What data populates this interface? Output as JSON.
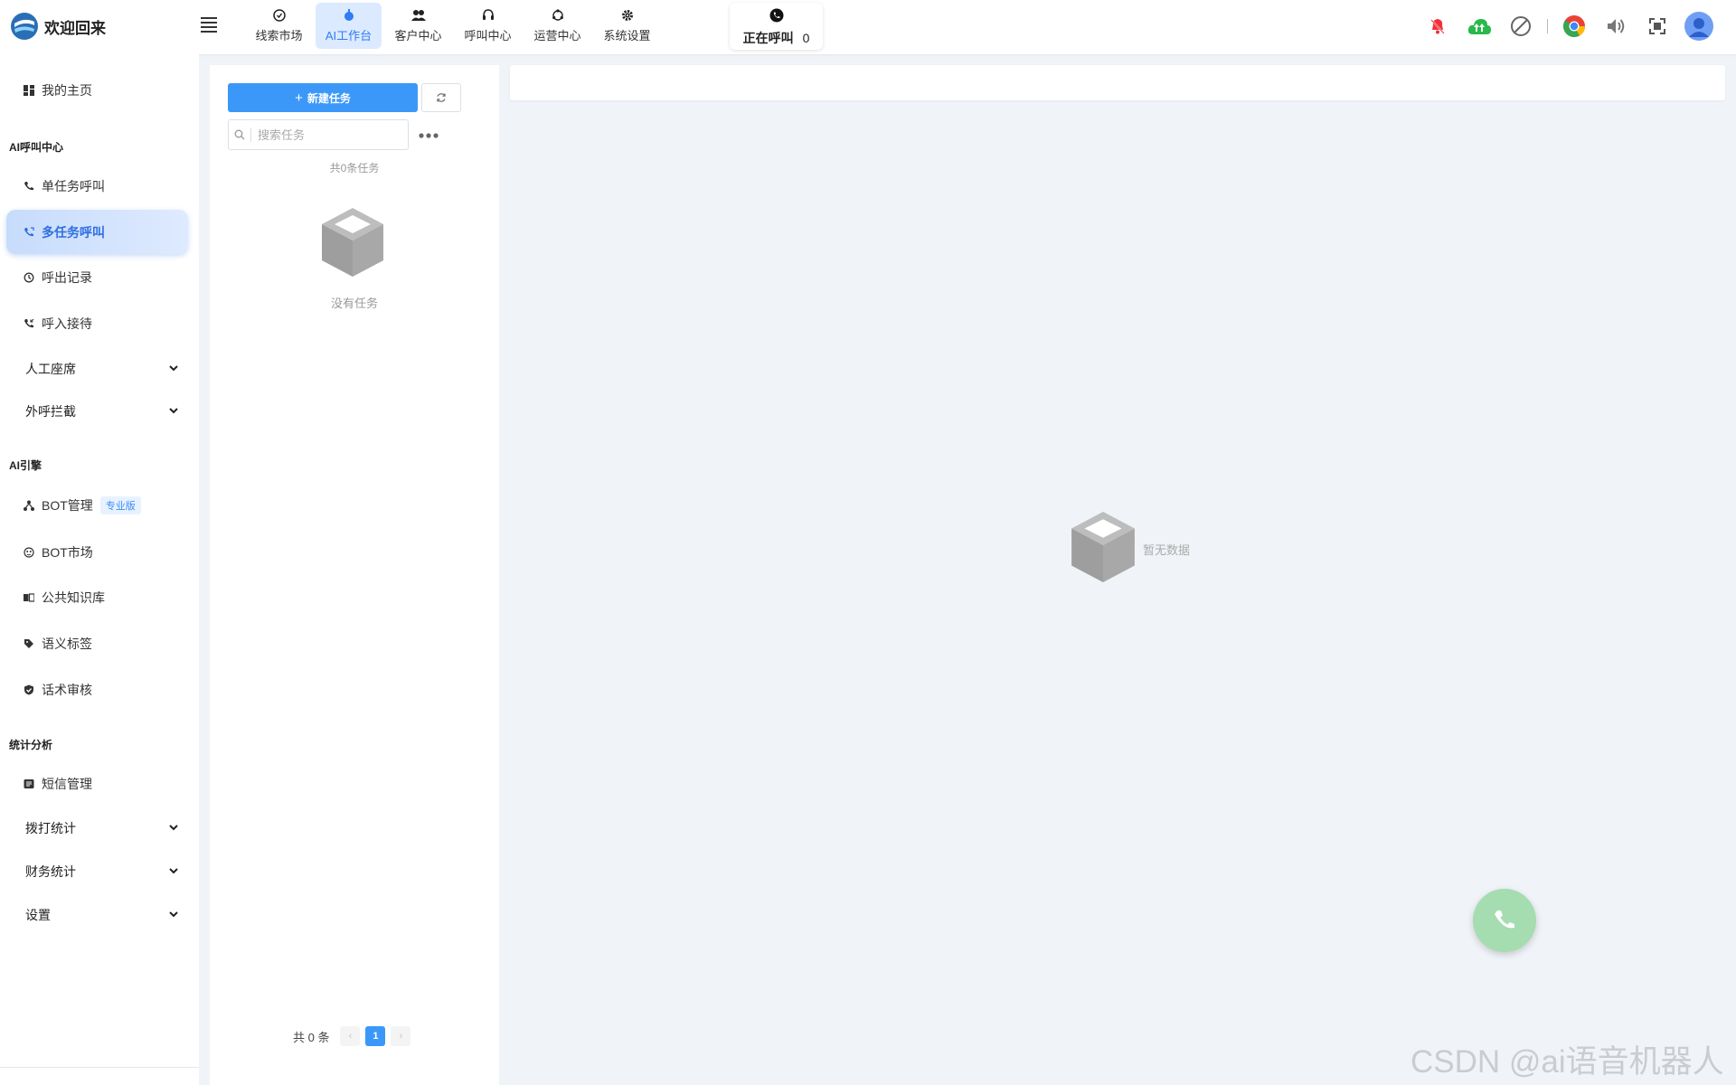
{
  "header": {
    "brand": "欢迎回来",
    "nav": [
      {
        "label": "线索市场",
        "icon": "compass-icon"
      },
      {
        "label": "AI工作台",
        "icon": "robot-icon",
        "active": true
      },
      {
        "label": "客户中心",
        "icon": "users-icon"
      },
      {
        "label": "呼叫中心",
        "icon": "headset-icon"
      },
      {
        "label": "运营中心",
        "icon": "cycle-icon"
      },
      {
        "label": "系统设置",
        "icon": "gear-icon"
      }
    ],
    "calling": {
      "label": "正在呼叫",
      "count": "0"
    },
    "right_icons": [
      "bell-off-icon",
      "cloud-upload-icon",
      "block-icon",
      "chrome-icon",
      "volume-icon",
      "fullscreen-icon",
      "avatar"
    ]
  },
  "sidebar": {
    "home": "我的主页",
    "sections": {
      "ai_call": "AI呼叫中心",
      "ai_engine": "AI引擎",
      "stats": "统计分析"
    },
    "items": {
      "single_call": "单任务呼叫",
      "multi_call": "多任务呼叫",
      "outbound_records": "呼出记录",
      "inbound": "呼入接待",
      "agents": "人工座席",
      "intercept": "外呼拦截",
      "bot_manage": "BOT管理",
      "bot_manage_tag": "专业版",
      "bot_market": "BOT市场",
      "knowledge": "公共知识库",
      "semantic_tags": "语义标签",
      "script_review": "话术审核",
      "sms": "短信管理",
      "dial_stats": "拨打统计",
      "finance_stats": "财务统计",
      "settings": "设置"
    }
  },
  "task_panel": {
    "new_task": "新建任务",
    "search_placeholder": "搜索任务",
    "count_text": "共0条任务",
    "empty_text": "没有任务",
    "pager": {
      "total": "共 0 条",
      "current_page": "1"
    }
  },
  "main": {
    "empty_text": "暂无数据"
  },
  "watermark": "CSDN @ai语音机器人",
  "colors": {
    "primary": "#3c98f8",
    "active_nav_bg": "#dceaff",
    "fab": "#a5dcb0"
  }
}
